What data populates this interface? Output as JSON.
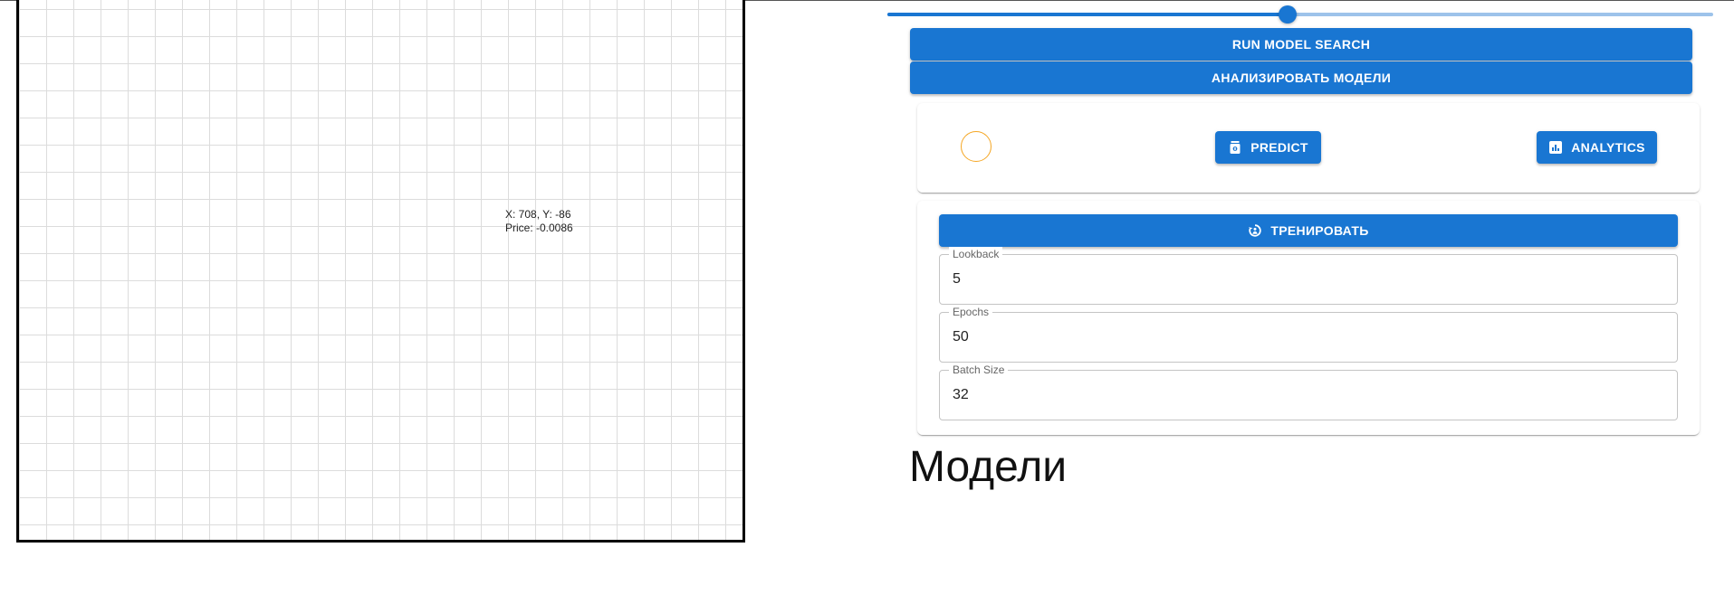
{
  "chart": {
    "crosshair_xy": "X: 708, Y: -86",
    "crosshair_price": "Price: -0.0086"
  },
  "slider": {
    "value_fraction": 0.485,
    "accent_color": "#1976d2",
    "rail_color": "#9dc3ea"
  },
  "buttons": {
    "run_model_search": "RUN MODEL SEARCH",
    "analyze_models": "АНАЛИЗИРОВАТЬ МОДЕЛИ",
    "predict": "PREDICT",
    "analytics": "ANALYTICS",
    "train": "ТРЕНИРОВАТЬ"
  },
  "icons": {
    "predict": "predict-icon",
    "analytics": "bar-chart-icon",
    "train": "training-cycle-icon"
  },
  "status_indicator": {
    "color": "#f5a623"
  },
  "training_form": {
    "lookback": {
      "label": "Lookback",
      "value": "5"
    },
    "epochs": {
      "label": "Epochs",
      "value": "50"
    },
    "batch_size": {
      "label": "Batch Size",
      "value": "32"
    }
  },
  "models_section": {
    "title": "Модели"
  }
}
